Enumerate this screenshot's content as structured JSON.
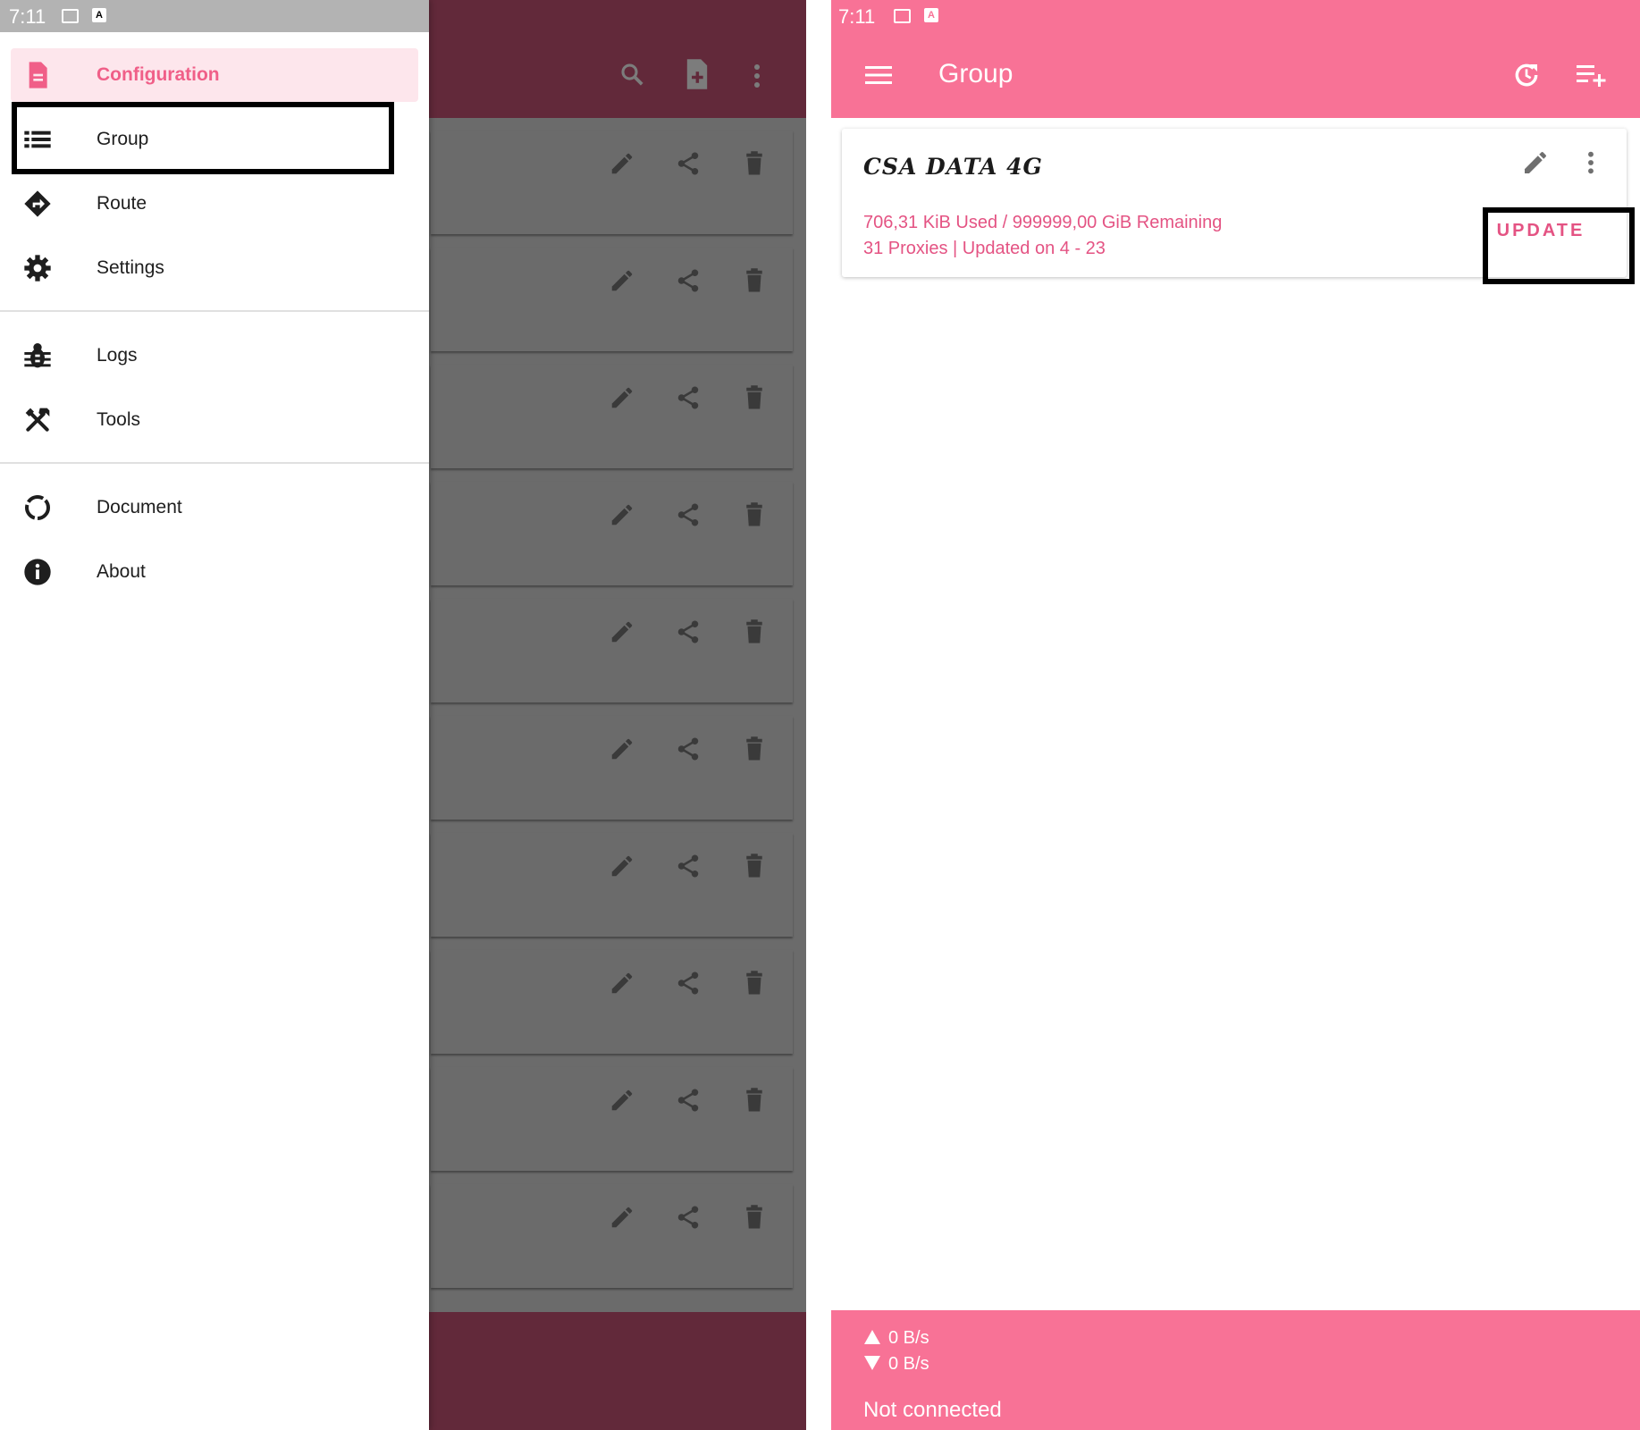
{
  "left_screen": {
    "status_time": "7:11",
    "drawer": {
      "items": [
        {
          "label": "Configuration",
          "icon": "document-icon",
          "active": true
        },
        {
          "label": "Group",
          "icon": "list-icon"
        },
        {
          "label": "Route",
          "icon": "route-icon"
        },
        {
          "label": "Settings",
          "icon": "gear-icon"
        },
        {
          "label": "Logs",
          "icon": "bug-icon"
        },
        {
          "label": "Tools",
          "icon": "tools-icon"
        },
        {
          "label": "Document",
          "icon": "circle-progress-icon"
        },
        {
          "label": "About",
          "icon": "info-icon"
        }
      ],
      "highlighted_item": "Group"
    },
    "background_toolbar_icons": [
      "search-icon",
      "add-file-icon",
      "more-vert-icon"
    ],
    "background_card_icons": [
      "edit-icon",
      "share-icon",
      "delete-icon"
    ],
    "colors": {
      "accent": "#f05f88",
      "dim_toolbar": "#62293a",
      "scrim": "#6b6b6b"
    }
  },
  "right_screen": {
    "status_time": "7:11",
    "appbar": {
      "title": "Group",
      "icons": [
        "menu-icon",
        "refresh-icon",
        "playlist-add-icon"
      ]
    },
    "group_card": {
      "name": "CSA DATA 4G",
      "usage": "706,31 KiB Used / 999999,00 GiB Remaining",
      "details": "31 Proxies | Updated on 4 - 23",
      "update_label": "UPDATE"
    },
    "footer": {
      "upload": "0 B/s",
      "download": "0 B/s",
      "connection": "Not connected"
    },
    "colors": {
      "primary": "#f87296",
      "accent_text": "#e45383"
    }
  }
}
